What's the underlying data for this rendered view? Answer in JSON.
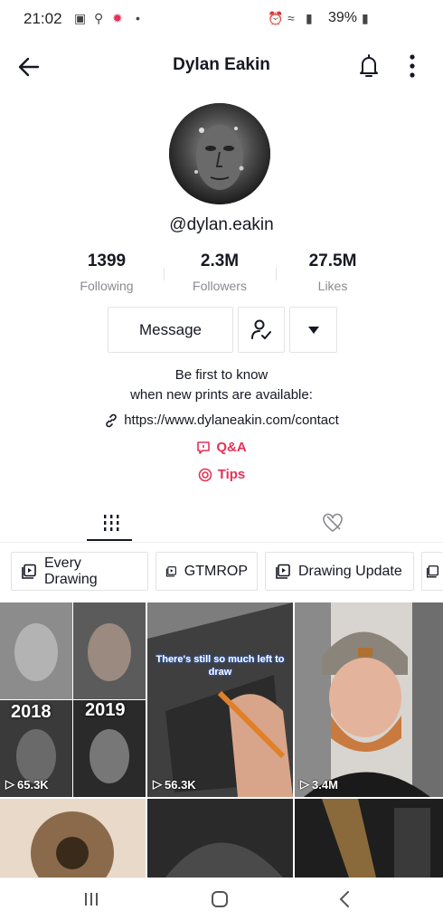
{
  "status": {
    "time": "21:02",
    "battery": "39%"
  },
  "header": {
    "title": "Dylan Eakin"
  },
  "profile": {
    "handle": "@dylan.eakin",
    "stats": [
      {
        "value": "1399",
        "label": "Following"
      },
      {
        "value": "2.3M",
        "label": "Followers"
      },
      {
        "value": "27.5M",
        "label": "Likes"
      }
    ],
    "message_label": "Message",
    "bio_line1": "Be first to know",
    "bio_line2": "when new prints are available:",
    "link": "https://www.dylaneakin.com/contact",
    "qa_label": "Q&A",
    "tips_label": "Tips"
  },
  "playlists": [
    "Every Drawing",
    "GTMROP",
    "Drawing Update"
  ],
  "videos": [
    {
      "views": "65.3K",
      "labels": [
        "2018",
        "2019"
      ]
    },
    {
      "views": "56.3K",
      "overlay": "There's still so much left to draw"
    },
    {
      "views": "3.4M"
    },
    {
      "views": ""
    },
    {
      "views": ""
    },
    {
      "views": ""
    }
  ]
}
